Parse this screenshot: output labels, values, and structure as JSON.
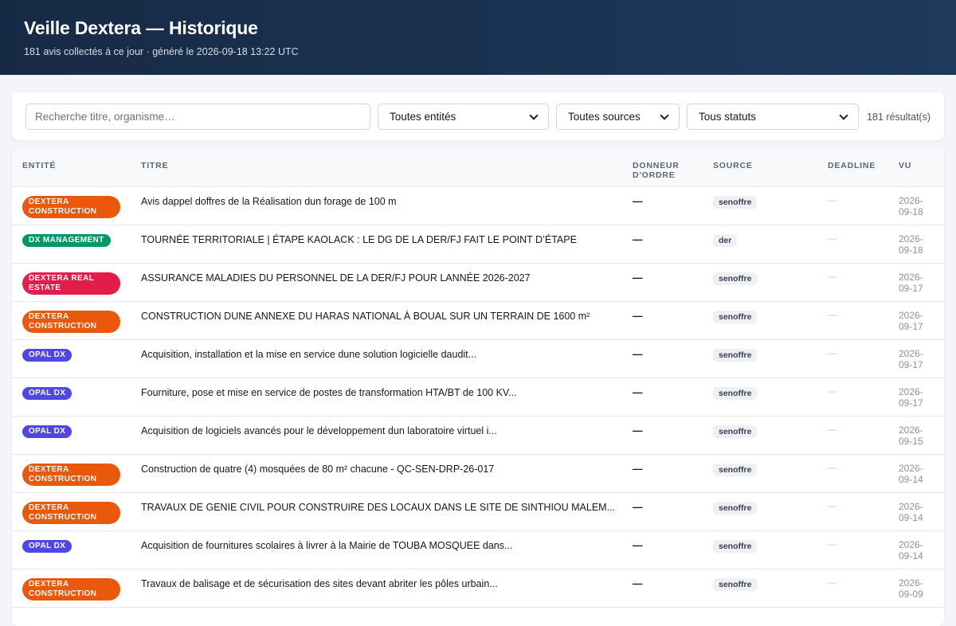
{
  "header": {
    "title": "Veille Dextera — Historique",
    "subtitle": "181 avis collectés à ce jour · généré le 2026-09-18 13:22 UTC"
  },
  "filters": {
    "search_placeholder": "Recherche titre, organisme…",
    "entity_select": "Toutes entités",
    "source_select": "Toutes sources",
    "status_select": "Tous statuts",
    "result_count": "181 résultat(s)"
  },
  "table": {
    "columns": {
      "entity": "ENTITÉ",
      "title": "TITRE",
      "donor": "DONNEUR D'ORDRE",
      "source": "SOURCE",
      "deadline": "DEADLINE",
      "seen": "VU"
    },
    "rows": [
      {
        "entity": "DEXTERA CONSTRUCTION",
        "entity_color": "#ea580c",
        "title": "Avis dappel doffres de la Réalisation dun forage de 100 m",
        "donor": "—",
        "source": "senoffre",
        "deadline": "—",
        "seen_1": "2026-",
        "seen_2": "09-18"
      },
      {
        "entity": "DX MANAGEMENT",
        "entity_color": "#059669",
        "title": "TOURNÉE TERRITORIALE | ÉTAPE KAOLACK : LE DG DE LA DER/FJ FAIT LE POINT D’ÉTAPE",
        "donor": "—",
        "source": "der",
        "deadline": "—",
        "seen_1": "2026-",
        "seen_2": "09-18"
      },
      {
        "entity": "DEXTERA REAL ESTATE",
        "entity_color": "#e11d48",
        "title": "ASSURANCE MALADIES DU PERSONNEL DE LA DER/FJ POUR LANNÉE 2026-2027",
        "donor": "—",
        "source": "senoffre",
        "deadline": "—",
        "seen_1": "2026-",
        "seen_2": "09-17"
      },
      {
        "entity": "DEXTERA CONSTRUCTION",
        "entity_color": "#ea580c",
        "title": "CONSTRUCTION DUNE ANNEXE DU HARAS NATIONAL À BOUAL SUR UN TERRAIN DE 1600 m²",
        "donor": "—",
        "source": "senoffre",
        "deadline": "—",
        "seen_1": "2026-",
        "seen_2": "09-17"
      },
      {
        "entity": "OPAL DX",
        "entity_color": "#4f46e5",
        "title": "Acquisition, installation et la mise en service dune solution logicielle daudit...",
        "donor": "—",
        "source": "senoffre",
        "deadline": "—",
        "seen_1": "2026-",
        "seen_2": "09-17"
      },
      {
        "entity": "OPAL DX",
        "entity_color": "#4f46e5",
        "title": "Fourniture, pose et mise en service de postes de transformation HTA/BT de 100 KV...",
        "donor": "—",
        "source": "senoffre",
        "deadline": "—",
        "seen_1": "2026-",
        "seen_2": "09-17"
      },
      {
        "entity": "OPAL DX",
        "entity_color": "#4f46e5",
        "title": "Acquisition de logiciels avancés pour le développement dun laboratoire virtuel i...",
        "donor": "—",
        "source": "senoffre",
        "deadline": "—",
        "seen_1": "2026-",
        "seen_2": "09-15"
      },
      {
        "entity": "DEXTERA CONSTRUCTION",
        "entity_color": "#ea580c",
        "title": "Construction de quatre (4) mosquées de 80 m² chacune - QC-SEN-DRP-26-017",
        "donor": "—",
        "source": "senoffre",
        "deadline": "—",
        "seen_1": "2026-",
        "seen_2": "09-14"
      },
      {
        "entity": "DEXTERA CONSTRUCTION",
        "entity_color": "#ea580c",
        "title": "TRAVAUX DE GENIE CIVIL POUR CONSTRUIRE DES LOCAUX DANS LE SITE DE SINTHIOU MALEM...",
        "donor": "—",
        "source": "senoffre",
        "deadline": "—",
        "seen_1": "2026-",
        "seen_2": "09-14"
      },
      {
        "entity": "OPAL DX",
        "entity_color": "#4f46e5",
        "title": "Acquisition de fournitures scolaires à livrer à la Mairie de TOUBA MOSQUEE dans...",
        "donor": "—",
        "source": "senoffre",
        "deadline": "—",
        "seen_1": "2026-",
        "seen_2": "09-14"
      },
      {
        "entity": "DEXTERA CONSTRUCTION",
        "entity_color": "#ea580c",
        "title": "Travaux de balisage et de sécurisation des sites devant abriter les pôles urbain...",
        "donor": "—",
        "source": "senoffre",
        "deadline": "—",
        "seen_1": "2026-",
        "seen_2": "09-09"
      }
    ]
  }
}
